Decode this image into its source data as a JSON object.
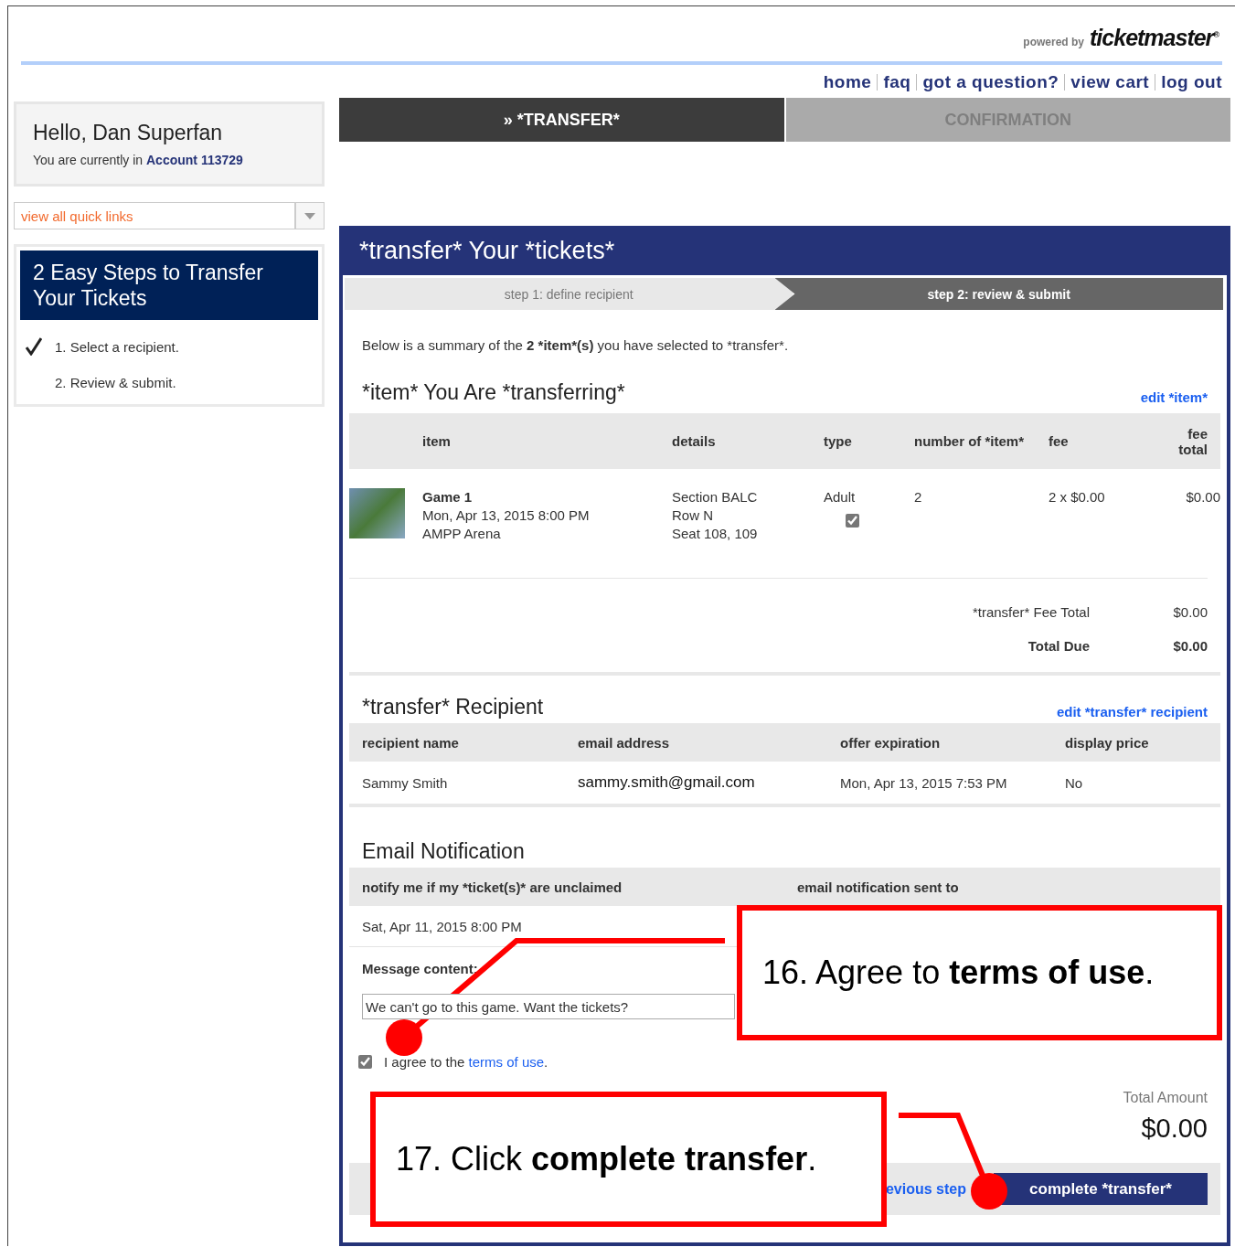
{
  "header": {
    "powered_by": "powered by",
    "brand": "ticketmaster$^{®}$"
  },
  "nav": [
    "home",
    "faq",
    "got a question?",
    "view cart",
    "log out"
  ],
  "greeting": {
    "title": "Hello, Dan Superfan",
    "account": [
      {
        "text": "You are currently in ",
        "bold": false
      },
      {
        "text": "Account 113729",
        "bold": true
      }
    ]
  },
  "quick_links": {
    "value": "view all quick links"
  },
  "steps_panel": {
    "title": "2 Easy Steps to Transfer Your Tickets",
    "steps": [
      {
        "label": "1. Select a recipient.",
        "done": true
      },
      {
        "label": "2. Review & submit.",
        "done": false
      }
    ]
  },
  "progress_tabs": [
    {
      "label": "» *TRANSFER*",
      "selected": true
    },
    {
      "label": "CONFIRMATION",
      "selected": false
    }
  ],
  "panel": {
    "title": "*transfer* Your *tickets*",
    "steps": [
      {
        "label": "step 1: define recipient",
        "selected": false
      },
      {
        "label": "step 2: review & submit",
        "selected": true
      }
    ],
    "summary": [
      {
        "text": "Below is a summary of the ",
        "bold": false
      },
      {
        "text": "2 *item*(s)",
        "bold": true
      },
      {
        "text": " you have selected to *transfer*.",
        "bold": false
      }
    ],
    "items": {
      "heading": "*item* You Are *transferring*",
      "edit_link": "edit *item*",
      "columns": [
        "item",
        "details",
        "type",
        "number of *item*",
        "fee",
        "fee total"
      ],
      "rows": [
        {
          "name": "Game 1",
          "date": "Mon, Apr 13, 2015 8:00 PM",
          "venue": "AMPP Arena",
          "details": [
            "Section BALC",
            "Row N",
            "Seat 108, 109"
          ],
          "type": "Adult",
          "checked": true,
          "quantity": "2",
          "fee": "2 x $0.00",
          "fee_total": "$0.00"
        }
      ],
      "totals": [
        {
          "label": "*transfer* Fee Total",
          "value": "$0.00",
          "bold": false
        },
        {
          "label": "Total Due",
          "value": "$0.00",
          "bold": true
        }
      ]
    },
    "recipient": {
      "heading": "*transfer* Recipient",
      "edit_link": "edit *transfer* recipient",
      "columns": [
        "recipient name",
        "email address",
        "offer expiration",
        "display price"
      ],
      "row": [
        "Sammy Smith",
        "sammy.smith@gmail.com",
        "Mon, Apr 13, 2015 7:53 PM",
        "No"
      ]
    },
    "email": {
      "heading": "Email Notification",
      "columns": [
        "notify me if my *ticket(s)* are unclaimed",
        "email notification sent to"
      ],
      "row": [
        "Sat, Apr 11, 2015 8:00 PM"
      ],
      "message_label": "Message content:",
      "message": "We can't go to this game. Want the tickets?"
    },
    "agree": {
      "checked": true,
      "parts": [
        {
          "text": "I agree to the ",
          "kind": "text"
        },
        {
          "text": "terms of use",
          "kind": "link"
        },
        {
          "text": ".",
          "kind": "text"
        }
      ]
    },
    "total": {
      "label": "Total Amount",
      "value": "$0.00"
    },
    "footer": {
      "back_link": "evious step",
      "submit": "complete *transfer*"
    }
  },
  "callouts": [
    {
      "text": "16. Agree to **terms of use**."
    },
    {
      "text": "17. Click **complete transfer**."
    }
  ]
}
